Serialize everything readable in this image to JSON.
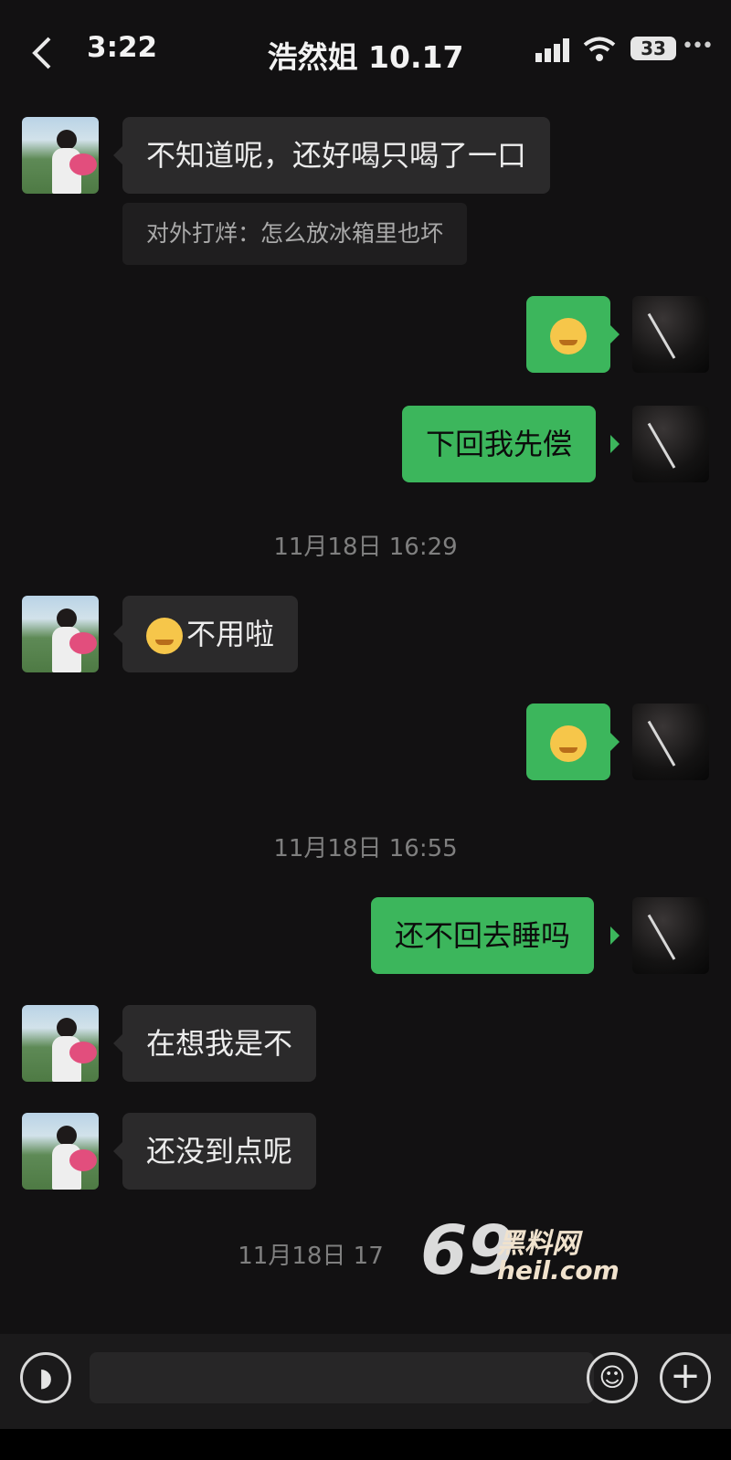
{
  "status_bar": {
    "time": "3:22",
    "battery": "33"
  },
  "header": {
    "back_icon": "chevron-left-icon",
    "title": "浩然姐 10.17"
  },
  "messages": [
    {
      "side": "left",
      "text": "不知道呢，还好喝只喝了一口",
      "quote": "对外打烊：怎么放冰箱里也坏"
    },
    {
      "side": "right",
      "emoji": "crying-laughing-emoji",
      "text": ""
    },
    {
      "side": "right",
      "text": "下回我先偿"
    },
    {
      "timestamp": "11月18日 16:29"
    },
    {
      "side": "left",
      "emoji": "kissing-emoji",
      "text": "不用啦"
    },
    {
      "side": "right",
      "emoji": "kissing-emoji",
      "text": ""
    },
    {
      "timestamp": "11月18日 16:55"
    },
    {
      "side": "right",
      "text": "还不回去睡吗"
    },
    {
      "side": "left",
      "text": "在想我是不"
    },
    {
      "side": "left",
      "text": "还没到点呢"
    },
    {
      "timestamp": "11月18日 17"
    }
  ],
  "watermark": {
    "number": "69",
    "name": "黑料网",
    "url": "heil.com"
  },
  "input_bar": {
    "voice_icon": "voice-icon",
    "emoji_icon": "emoji-icon",
    "plus_icon": "plus-icon",
    "placeholder": ""
  },
  "colors": {
    "background": "#121112",
    "my_bubble": "#3cb65c",
    "her_bubble": "#2b2a2b"
  }
}
